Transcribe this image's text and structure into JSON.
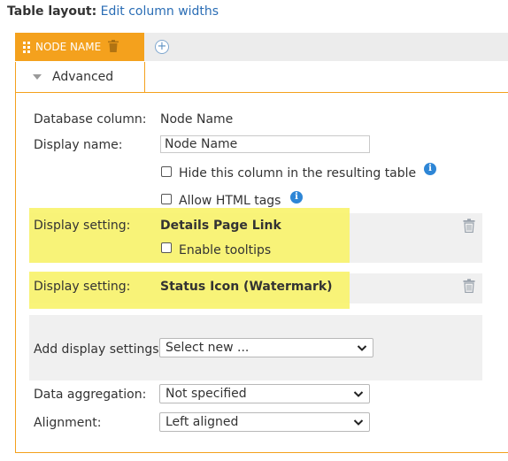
{
  "header": {
    "title": "Table layout:",
    "link": "Edit column widths"
  },
  "column_tab": {
    "label": "NODE NAME"
  },
  "subtab": {
    "label": "Advanced"
  },
  "form": {
    "database_column_label": "Database column:",
    "database_column_value": "Node Name",
    "display_name_label": "Display name:",
    "display_name_value": "Node Name",
    "hide_column_label": "Hide this column in the resulting table",
    "hide_column_checked": false,
    "allow_html_label": "Allow HTML tags",
    "allow_html_checked": false,
    "display_settings": [
      {
        "label": "Display setting:",
        "value": "Details Page Link",
        "option_label": "Enable tooltips",
        "option_checked": false
      },
      {
        "label": "Display setting:",
        "value": "Status Icon (Watermark)"
      }
    ],
    "add_display_settings_label": "Add display settings:",
    "add_display_settings_value": "Select new ...",
    "data_aggregation_label": "Data aggregation:",
    "data_aggregation_value": "Not specified",
    "alignment_label": "Alignment:",
    "alignment_value": "Left aligned"
  },
  "colors": {
    "accent": "#f4a11d",
    "link": "#2a6db5",
    "info": "#2e86d6",
    "highlight": "#f8f36a"
  },
  "icons": {
    "drag": "drag-handle-icon",
    "trash": "trash-icon",
    "add": "plus-circle-icon",
    "info": "info-icon",
    "expand": "triangle-down-icon",
    "dropdown": "chevron-down-icon"
  }
}
